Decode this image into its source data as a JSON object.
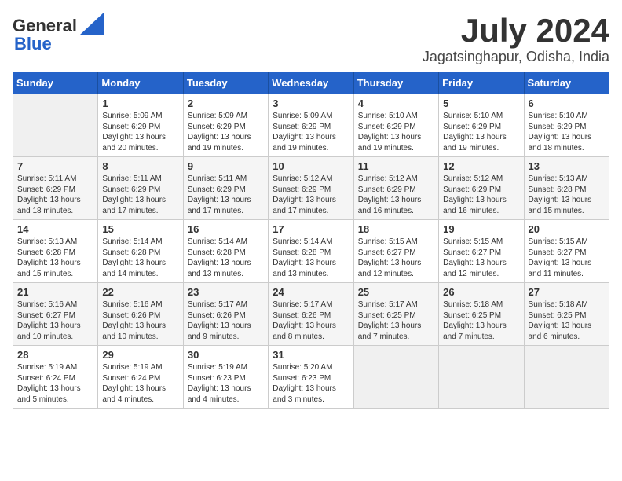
{
  "logo": {
    "general": "General",
    "blue": "Blue"
  },
  "title": "July 2024",
  "location": "Jagatsinghapur, Odisha, India",
  "days_of_week": [
    "Sunday",
    "Monday",
    "Tuesday",
    "Wednesday",
    "Thursday",
    "Friday",
    "Saturday"
  ],
  "weeks": [
    [
      {
        "day": "",
        "sunrise": "",
        "sunset": "",
        "daylight": ""
      },
      {
        "day": "1",
        "sunrise": "Sunrise: 5:09 AM",
        "sunset": "Sunset: 6:29 PM",
        "daylight": "Daylight: 13 hours and 20 minutes."
      },
      {
        "day": "2",
        "sunrise": "Sunrise: 5:09 AM",
        "sunset": "Sunset: 6:29 PM",
        "daylight": "Daylight: 13 hours and 19 minutes."
      },
      {
        "day": "3",
        "sunrise": "Sunrise: 5:09 AM",
        "sunset": "Sunset: 6:29 PM",
        "daylight": "Daylight: 13 hours and 19 minutes."
      },
      {
        "day": "4",
        "sunrise": "Sunrise: 5:10 AM",
        "sunset": "Sunset: 6:29 PM",
        "daylight": "Daylight: 13 hours and 19 minutes."
      },
      {
        "day": "5",
        "sunrise": "Sunrise: 5:10 AM",
        "sunset": "Sunset: 6:29 PM",
        "daylight": "Daylight: 13 hours and 19 minutes."
      },
      {
        "day": "6",
        "sunrise": "Sunrise: 5:10 AM",
        "sunset": "Sunset: 6:29 PM",
        "daylight": "Daylight: 13 hours and 18 minutes."
      }
    ],
    [
      {
        "day": "7",
        "sunrise": "Sunrise: 5:11 AM",
        "sunset": "Sunset: 6:29 PM",
        "daylight": "Daylight: 13 hours and 18 minutes."
      },
      {
        "day": "8",
        "sunrise": "Sunrise: 5:11 AM",
        "sunset": "Sunset: 6:29 PM",
        "daylight": "Daylight: 13 hours and 17 minutes."
      },
      {
        "day": "9",
        "sunrise": "Sunrise: 5:11 AM",
        "sunset": "Sunset: 6:29 PM",
        "daylight": "Daylight: 13 hours and 17 minutes."
      },
      {
        "day": "10",
        "sunrise": "Sunrise: 5:12 AM",
        "sunset": "Sunset: 6:29 PM",
        "daylight": "Daylight: 13 hours and 17 minutes."
      },
      {
        "day": "11",
        "sunrise": "Sunrise: 5:12 AM",
        "sunset": "Sunset: 6:29 PM",
        "daylight": "Daylight: 13 hours and 16 minutes."
      },
      {
        "day": "12",
        "sunrise": "Sunrise: 5:12 AM",
        "sunset": "Sunset: 6:29 PM",
        "daylight": "Daylight: 13 hours and 16 minutes."
      },
      {
        "day": "13",
        "sunrise": "Sunrise: 5:13 AM",
        "sunset": "Sunset: 6:28 PM",
        "daylight": "Daylight: 13 hours and 15 minutes."
      }
    ],
    [
      {
        "day": "14",
        "sunrise": "Sunrise: 5:13 AM",
        "sunset": "Sunset: 6:28 PM",
        "daylight": "Daylight: 13 hours and 15 minutes."
      },
      {
        "day": "15",
        "sunrise": "Sunrise: 5:14 AM",
        "sunset": "Sunset: 6:28 PM",
        "daylight": "Daylight: 13 hours and 14 minutes."
      },
      {
        "day": "16",
        "sunrise": "Sunrise: 5:14 AM",
        "sunset": "Sunset: 6:28 PM",
        "daylight": "Daylight: 13 hours and 13 minutes."
      },
      {
        "day": "17",
        "sunrise": "Sunrise: 5:14 AM",
        "sunset": "Sunset: 6:28 PM",
        "daylight": "Daylight: 13 hours and 13 minutes."
      },
      {
        "day": "18",
        "sunrise": "Sunrise: 5:15 AM",
        "sunset": "Sunset: 6:27 PM",
        "daylight": "Daylight: 13 hours and 12 minutes."
      },
      {
        "day": "19",
        "sunrise": "Sunrise: 5:15 AM",
        "sunset": "Sunset: 6:27 PM",
        "daylight": "Daylight: 13 hours and 12 minutes."
      },
      {
        "day": "20",
        "sunrise": "Sunrise: 5:15 AM",
        "sunset": "Sunset: 6:27 PM",
        "daylight": "Daylight: 13 hours and 11 minutes."
      }
    ],
    [
      {
        "day": "21",
        "sunrise": "Sunrise: 5:16 AM",
        "sunset": "Sunset: 6:27 PM",
        "daylight": "Daylight: 13 hours and 10 minutes."
      },
      {
        "day": "22",
        "sunrise": "Sunrise: 5:16 AM",
        "sunset": "Sunset: 6:26 PM",
        "daylight": "Daylight: 13 hours and 10 minutes."
      },
      {
        "day": "23",
        "sunrise": "Sunrise: 5:17 AM",
        "sunset": "Sunset: 6:26 PM",
        "daylight": "Daylight: 13 hours and 9 minutes."
      },
      {
        "day": "24",
        "sunrise": "Sunrise: 5:17 AM",
        "sunset": "Sunset: 6:26 PM",
        "daylight": "Daylight: 13 hours and 8 minutes."
      },
      {
        "day": "25",
        "sunrise": "Sunrise: 5:17 AM",
        "sunset": "Sunset: 6:25 PM",
        "daylight": "Daylight: 13 hours and 7 minutes."
      },
      {
        "day": "26",
        "sunrise": "Sunrise: 5:18 AM",
        "sunset": "Sunset: 6:25 PM",
        "daylight": "Daylight: 13 hours and 7 minutes."
      },
      {
        "day": "27",
        "sunrise": "Sunrise: 5:18 AM",
        "sunset": "Sunset: 6:25 PM",
        "daylight": "Daylight: 13 hours and 6 minutes."
      }
    ],
    [
      {
        "day": "28",
        "sunrise": "Sunrise: 5:19 AM",
        "sunset": "Sunset: 6:24 PM",
        "daylight": "Daylight: 13 hours and 5 minutes."
      },
      {
        "day": "29",
        "sunrise": "Sunrise: 5:19 AM",
        "sunset": "Sunset: 6:24 PM",
        "daylight": "Daylight: 13 hours and 4 minutes."
      },
      {
        "day": "30",
        "sunrise": "Sunrise: 5:19 AM",
        "sunset": "Sunset: 6:23 PM",
        "daylight": "Daylight: 13 hours and 4 minutes."
      },
      {
        "day": "31",
        "sunrise": "Sunrise: 5:20 AM",
        "sunset": "Sunset: 6:23 PM",
        "daylight": "Daylight: 13 hours and 3 minutes."
      },
      {
        "day": "",
        "sunrise": "",
        "sunset": "",
        "daylight": ""
      },
      {
        "day": "",
        "sunrise": "",
        "sunset": "",
        "daylight": ""
      },
      {
        "day": "",
        "sunrise": "",
        "sunset": "",
        "daylight": ""
      }
    ]
  ]
}
